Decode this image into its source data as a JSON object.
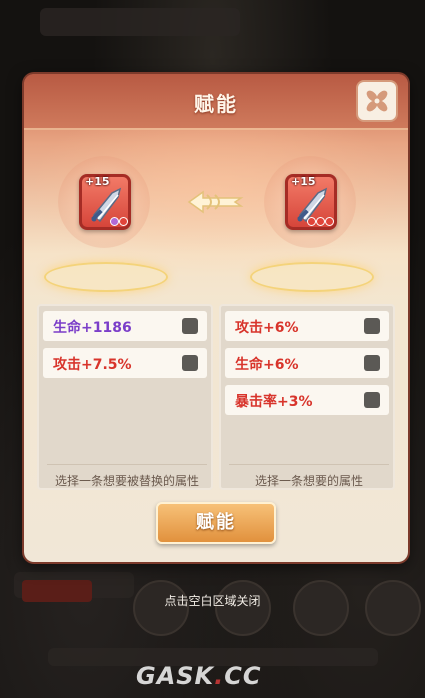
{
  "dialog": {
    "title": "赋能",
    "close_icon": "close-flower-icon",
    "source_item": {
      "level": "+15",
      "icon": "sword-icon",
      "dots": [
        "#b06ad6",
        "#e0443a"
      ]
    },
    "target_item": {
      "level": "+15",
      "icon": "sword-icon",
      "dots": [
        "#e0443a",
        "#e0443a",
        "#e0443a"
      ]
    },
    "transfer_icon": "arrow-left-icon"
  },
  "left_list": {
    "attrs": [
      {
        "label": "生命+1186",
        "color": "#7b3ec9"
      },
      {
        "label": "攻击+7.5%",
        "color": "#d8342b"
      }
    ],
    "hint": "选择一条想要被替换的属性"
  },
  "right_list": {
    "attrs": [
      {
        "label": "攻击+6%",
        "color": "#d8342b"
      },
      {
        "label": "生命+6%",
        "color": "#d8342b"
      },
      {
        "label": "暴击率+3%",
        "color": "#d8342b"
      }
    ],
    "hint": "选择一条想要的属性"
  },
  "confirm_label": "赋能",
  "close_hint": "点击空白区域关闭",
  "watermark": {
    "left": "GASK",
    "sep": ".",
    "right": "CC"
  },
  "colors": {
    "accent": "#cf7a5c",
    "button": "#e1913d"
  }
}
